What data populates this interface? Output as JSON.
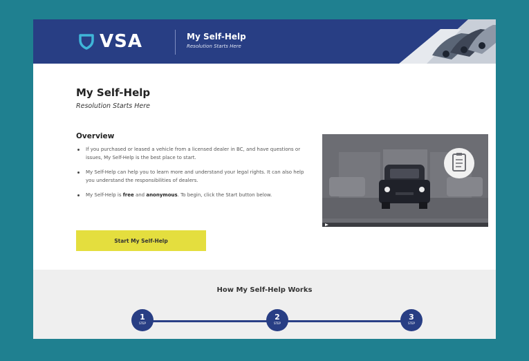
{
  "header": {
    "logo_text": "VSA",
    "title": "My Self-Help",
    "subtitle": "Resolution Starts Here"
  },
  "intro": {
    "title": "My Self-Help",
    "subtitle": "Resolution Starts Here"
  },
  "overview": {
    "heading": "Overview",
    "bullet_1": "If you purchased or leased a vehicle from a licensed dealer in BC, and have questions or issues, My Self-Help is the best place to start.",
    "bullet_2": "My Self-Help can help you to learn more and understand your legal rights. It can also help you understand the responsibilities of dealers.",
    "bullet_3_pre": "My Self-Help is ",
    "bullet_3_free": "free",
    "bullet_3_mid": " and ",
    "bullet_3_anon": "anonymous",
    "bullet_3_post": ". To begin, click the Start button below."
  },
  "start_button_label": "Start My Self-Help",
  "how": {
    "title": "How My Self-Help Works",
    "steps": [
      {
        "number": "1",
        "word": "STEP"
      },
      {
        "number": "2",
        "word": "STEP"
      },
      {
        "number": "3",
        "word": "STEP"
      }
    ]
  },
  "colors": {
    "background": "#1f8090",
    "header": "#283e84",
    "button": "#e4de3e",
    "logo_accent": "#3fb6d8"
  }
}
